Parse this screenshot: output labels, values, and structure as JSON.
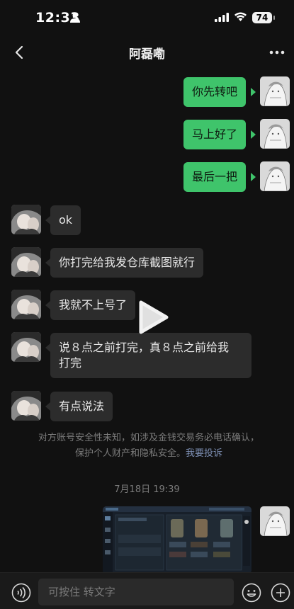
{
  "status": {
    "time": "12:33",
    "battery": "74"
  },
  "header": {
    "title": "阿磊嘞"
  },
  "messages": [
    {
      "side": "right",
      "text": "你先转吧"
    },
    {
      "side": "right",
      "text": "马上好了"
    },
    {
      "side": "right",
      "text": "最后一把"
    },
    {
      "side": "left",
      "text": "ok"
    },
    {
      "side": "left",
      "text": "你打完给我发仓库截图就行"
    },
    {
      "side": "left",
      "text": "我就不上号了"
    },
    {
      "side": "left",
      "text_line1": "说８点之前打完，真８点之前给我",
      "text_line2": "打完"
    },
    {
      "side": "left",
      "text": "有点说法"
    }
  ],
  "notice": {
    "line1": "对方账号安全性未知，如涉及金钱交易务必电话确认，",
    "line2": "保护个人财产和隐私安全。",
    "link": "我要投诉"
  },
  "timestamp": "7月18日 19:39",
  "input": {
    "placeholder": "可按住 转文字"
  },
  "colors": {
    "sent_bubble": "#3fc46b",
    "recv_bubble": "#2c2c2c",
    "background": "#111111"
  },
  "icons": [
    "person-icon",
    "signal-icon",
    "wifi-icon",
    "back-icon",
    "more-icon",
    "play-icon",
    "voice-icon",
    "emoji-icon",
    "plus-icon"
  ]
}
